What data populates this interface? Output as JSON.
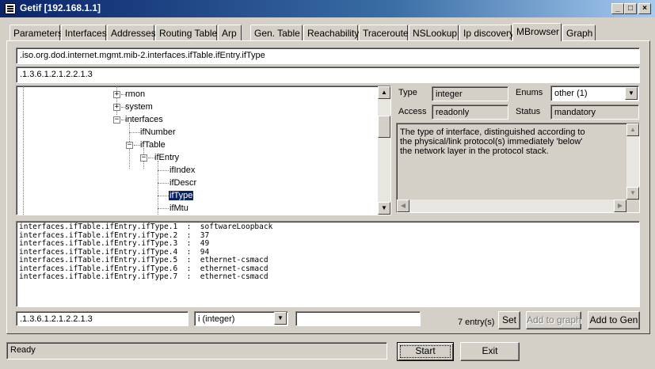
{
  "window": {
    "title": "Getif [192.168.1.1]",
    "controls": {
      "minimize": "_",
      "maximize": "□",
      "close": "×"
    }
  },
  "tabs": [
    {
      "label": "Parameters"
    },
    {
      "label": "Interfaces"
    },
    {
      "label": "Addresses"
    },
    {
      "label": "Routing Table"
    },
    {
      "label": "Arp"
    },
    {
      "label": "Gen. Table"
    },
    {
      "label": "Reachability"
    },
    {
      "label": "Traceroute"
    },
    {
      "label": "NSLookup"
    },
    {
      "label": "Ip discovery"
    },
    {
      "label": "MBrowser",
      "active": true
    },
    {
      "label": "Graph"
    }
  ],
  "mbrowser": {
    "oid_path": ".iso.org.dod.internet.mgmt.mib-2.interfaces.ifTable.ifEntry.ifType",
    "oid_numeric": ".1.3.6.1.2.1.2.2.1.3",
    "tree": {
      "rmon": "rmon",
      "system": "system",
      "interfaces": "interfaces",
      "ifNumber": "ifNumber",
      "ifTable": "ifTable",
      "ifEntry": "ifEntry",
      "ifIndex": "ifIndex",
      "ifDescr": "ifDescr",
      "ifType": "ifType",
      "ifMtu": "ifMtu"
    },
    "details": {
      "type_label": "Type",
      "type_value": "integer",
      "enums_label": "Enums",
      "enums_value": "other (1)",
      "access_label": "Access",
      "access_value": "readonly",
      "status_label": "Status",
      "status_value": "mandatory",
      "description_lines": [
        "The type of interface, distinguished according to",
        "the physical/link protocol(s) immediately 'below'",
        "the network layer in the protocol stack."
      ]
    },
    "results": [
      "interfaces.ifTable.ifEntry.ifType.1  :  softwareLoopback",
      "interfaces.ifTable.ifEntry.ifType.2  :  37",
      "interfaces.ifTable.ifEntry.ifType.3  :  49",
      "interfaces.ifTable.ifEntry.ifType.4  :  94",
      "interfaces.ifTable.ifEntry.ifType.5  :  ethernet-csmacd",
      "interfaces.ifTable.ifEntry.ifType.6  :  ethernet-csmacd",
      "interfaces.ifTable.ifEntry.ifType.7  :  ethernet-csmacd"
    ],
    "set_oid": ".1.3.6.1.2.1.2.2.1.3",
    "set_type": "i (integer)",
    "set_value": "",
    "entry_count": "7 entry(s)",
    "buttons": {
      "set": "Set",
      "add_to_graph": "Add to graph",
      "add_to_gen": "Add to Gen"
    }
  },
  "statusbar": {
    "status": "Ready",
    "start": "Start",
    "exit": "Exit"
  },
  "colors": {
    "titlebar": "#0a246a",
    "face": "#d4d0c8",
    "selection": "#0a246a"
  }
}
